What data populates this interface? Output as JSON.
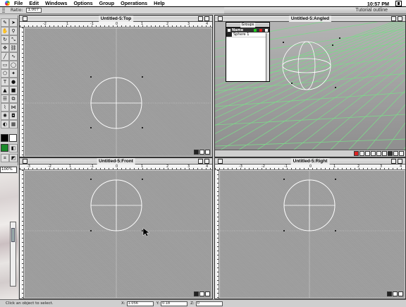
{
  "menubar": {
    "items": [
      "File",
      "Edit",
      "Windows",
      "Options",
      "Group",
      "Operations",
      "Help"
    ],
    "clock": "10:57 PM"
  },
  "ratio_bar": {
    "label": "Ratio:",
    "value": "1.007"
  },
  "background_window": {
    "title": "Tutorial outline"
  },
  "windows": {
    "top": {
      "title": "Untitled-5:Top"
    },
    "angled": {
      "title": "Untitled-5:Angled"
    },
    "front": {
      "title": "Untitled-5:Front"
    },
    "right": {
      "title": "Untitled-5:Right"
    }
  },
  "rulers": {
    "top": [
      "-2",
      "1",
      "-1",
      "0",
      "1",
      "2",
      "3",
      "4"
    ],
    "front": [
      "-3",
      "-2",
      "1",
      "-1",
      "0",
      "1",
      "2",
      "3",
      "4"
    ],
    "right": [
      "-3",
      "-2",
      "-1",
      "0",
      "1",
      "2",
      "3",
      "4"
    ]
  },
  "zoom": {
    "value": "100%"
  },
  "groups_palette": {
    "title": "Groups",
    "column_name": "Name",
    "items": [
      {
        "name": "Sphere 1"
      }
    ]
  },
  "statusbar": {
    "message": "Click an object to select.",
    "x_label": "X:",
    "x_value": "1.056",
    "y_label": "Y:",
    "y_value": "0.18",
    "z_label": "Z:",
    "z_value": "0"
  },
  "colors": {
    "canvas": "#9a9a9a",
    "grid_green": "#7dd88a",
    "swatch_green": "#1a8a2a",
    "swatch_black": "#000000",
    "swatch_white": "#ffffff"
  }
}
